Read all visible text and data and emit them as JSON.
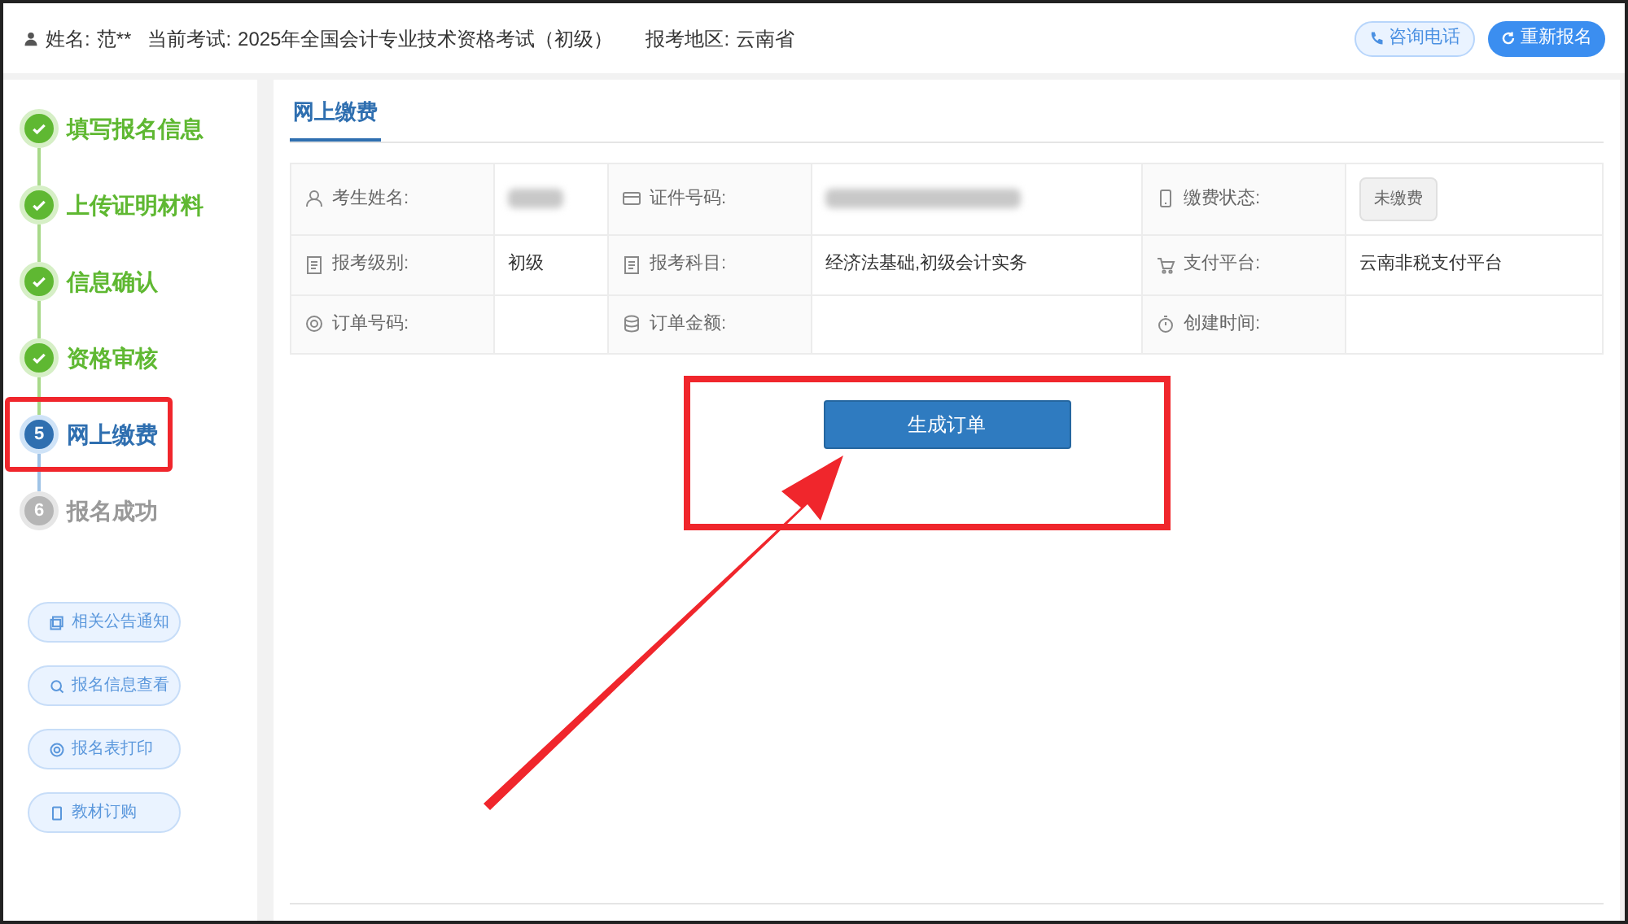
{
  "header": {
    "name_label": "姓名:",
    "name_value": "范**",
    "exam_label": "当前考试:",
    "exam_value": "2025年全国会计专业技术资格考试（初级）",
    "region_label": "报考地区:",
    "region_value": "云南省",
    "buttons": [
      {
        "label": "咨询电话",
        "kind": "outline"
      },
      {
        "label": "重新报名",
        "kind": "primary"
      }
    ]
  },
  "steps": [
    {
      "label": "填写报名信息",
      "done": true,
      "current": false,
      "highlighted": false
    },
    {
      "label": "上传证明材料",
      "done": true,
      "current": false,
      "highlighted": false
    },
    {
      "label": "信息确认",
      "done": true,
      "current": false,
      "highlighted": false
    },
    {
      "label": "资格审核",
      "done": true,
      "current": false,
      "highlighted": false
    },
    {
      "number": "5",
      "label": "网上缴费",
      "done": false,
      "current": true,
      "highlighted": true
    },
    {
      "number": "6",
      "label": "报名成功",
      "done": false,
      "current": false,
      "highlighted": false
    }
  ],
  "side_links": [
    "相关公告通知",
    "报名信息查看",
    "报名表打印",
    "教材订购"
  ],
  "tab": {
    "label": "网上缴费",
    "selected": true
  },
  "table": {
    "rows": [
      [
        {
          "label": "考生姓名:",
          "kind": "redacted"
        },
        {
          "label": "证件号码:",
          "kind": "redacted"
        },
        {
          "label": "缴费状态:",
          "kind": "badge",
          "value": "未缴费"
        }
      ],
      [
        {
          "label": "报考级别:",
          "kind": "text",
          "value": "初级"
        },
        {
          "label": "报考科目:",
          "kind": "text",
          "value": "经济法基础,初级会计实务"
        },
        {
          "label": "支付平台:",
          "kind": "text",
          "value": "云南非税支付平台"
        }
      ],
      [
        {
          "label": "订单号码:",
          "kind": "empty"
        },
        {
          "label": "订单金额:",
          "kind": "empty"
        },
        {
          "label": "创建时间:",
          "kind": "empty"
        }
      ]
    ]
  },
  "generate_button": {
    "label": "生成订单",
    "highlighted": true
  }
}
